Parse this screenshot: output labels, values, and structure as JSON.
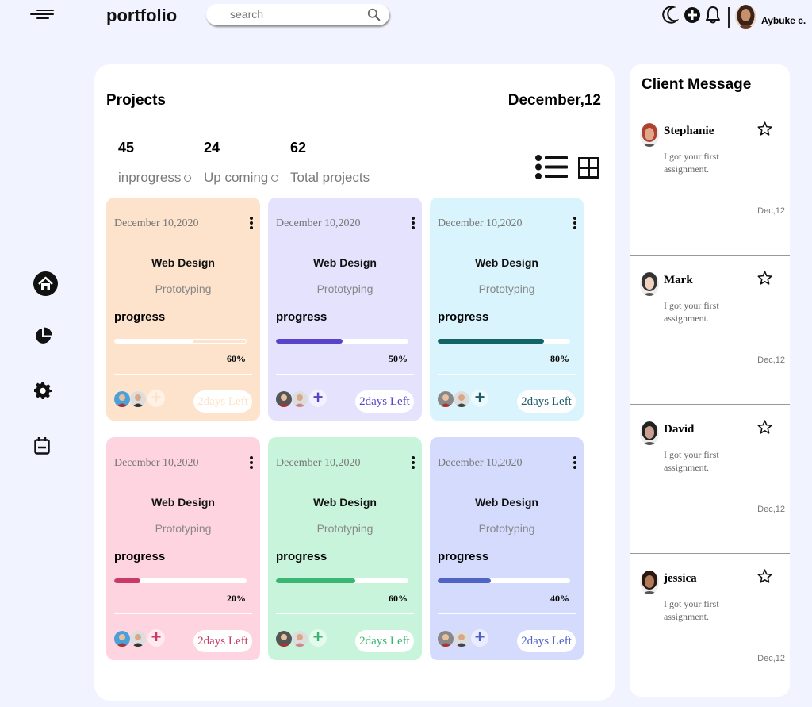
{
  "header": {
    "brand": "portfolio",
    "search_placeholder": "search",
    "user_name": "Aybuke c."
  },
  "nav": {
    "items": [
      "home-icon",
      "pie-chart-icon",
      "gear-icon",
      "calendar-icon"
    ]
  },
  "projects": {
    "title": "Projects",
    "date": "December,12",
    "stats": [
      {
        "value": "45",
        "label": "inprogress"
      },
      {
        "value": "24",
        "label": "Up coming"
      },
      {
        "value": "62",
        "label": "Total projects"
      }
    ],
    "cards": [
      {
        "date": "December 10,2020",
        "title": "Web Design",
        "subtitle": "Prototyping",
        "progress_label": "progress",
        "progress": 60,
        "percent_text": "60%",
        "days_left": "2days Left",
        "bg": "#fde3cb",
        "accent": "#ffffff",
        "add_color": "#fde3cb",
        "days_color": "#fde3cb"
      },
      {
        "date": "December 10,2020",
        "title": "Web Design",
        "subtitle": "Prototyping",
        "progress_label": "progress",
        "progress": 50,
        "percent_text": "50%",
        "days_left": "2days Left",
        "bg": "#e5e2fd",
        "accent": "#5a43c8",
        "add_color": "#5a43c8",
        "days_color": "#5a43c8"
      },
      {
        "date": "December 10,2020",
        "title": "Web Design",
        "subtitle": "Prototyping",
        "progress_label": "progress",
        "progress": 80,
        "percent_text": "80%",
        "days_left": "2days Left",
        "bg": "#d9f4fc",
        "accent": "#136565",
        "add_color": "#1d5a68",
        "days_color": "#1d5a68"
      },
      {
        "date": "December 10,2020",
        "title": "Web Design",
        "subtitle": "Prototyping",
        "progress_label": "progress",
        "progress": 20,
        "percent_text": "20%",
        "days_left": "2days Left",
        "bg": "#ffd4e1",
        "accent": "#c83a6a",
        "add_color": "#c83a6a",
        "days_color": "#c83a6a"
      },
      {
        "date": "December 10,2020",
        "title": "Web Design",
        "subtitle": "Prototyping",
        "progress_label": "progress",
        "progress": 60,
        "percent_text": "60%",
        "days_left": "2days Left",
        "bg": "#c8f4db",
        "accent": "#3ab573",
        "add_color": "#3ab573",
        "days_color": "#3ab573"
      },
      {
        "date": "December 10,2020",
        "title": "Web Design",
        "subtitle": "Prototyping",
        "progress_label": "progress",
        "progress": 40,
        "percent_text": "40%",
        "days_left": "2days Left",
        "bg": "#d4dbfd",
        "accent": "#5064c6",
        "add_color": "#5064c6",
        "days_color": "#5064c6"
      }
    ]
  },
  "clients": {
    "title": "Client Message",
    "messages": [
      {
        "name": "Stephanie",
        "text": "I got your first assignment.",
        "date": "Dec,12"
      },
      {
        "name": "Mark",
        "text": "I got your first assignment.",
        "date": "Dec,12"
      },
      {
        "name": "David",
        "text": "I got your first assignment.",
        "date": "Dec,12"
      },
      {
        "name": "jessica",
        "text": "I got your first assignment.",
        "date": "Dec,12"
      }
    ]
  }
}
